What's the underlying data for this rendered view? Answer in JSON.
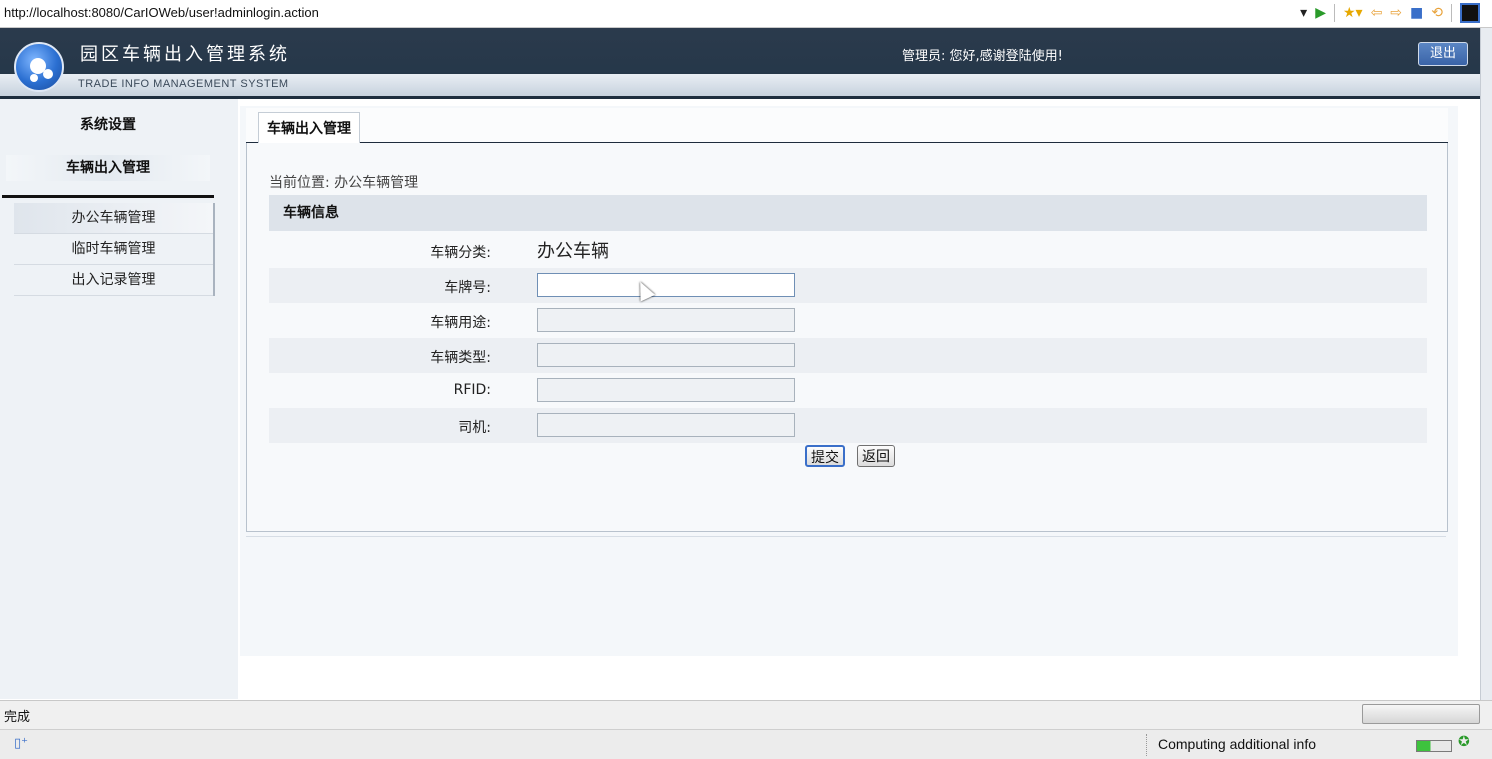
{
  "browser": {
    "url": "http://localhost:8080/CarIOWeb/user!adminlogin.action",
    "toolbar_icons": [
      "dropdown-icon",
      "play-icon",
      "star-icon",
      "back-icon",
      "forward-icon",
      "stop-icon",
      "refresh-icon",
      "window-icon"
    ]
  },
  "header": {
    "title": "园区车辆出入管理系统",
    "subtitle": "TRADE INFO MANAGEMENT SYSTEM",
    "greeting": "管理员:  您好,感谢登陆使用!",
    "logout_label": "退出"
  },
  "sidebar": {
    "system_settings": "系统设置",
    "section": "车辆出入管理",
    "items": [
      {
        "label": "办公车辆管理"
      },
      {
        "label": "临时车辆管理"
      },
      {
        "label": "出入记录管理"
      }
    ]
  },
  "main": {
    "tab_label": "车辆出入管理",
    "breadcrumb": "当前位置:  办公车辆管理",
    "section_title": "车辆信息",
    "form": {
      "category_label": "车辆分类:",
      "category_value": "办公车辆",
      "plate_label": "车牌号:",
      "plate_value": "",
      "usage_label": "车辆用途:",
      "usage_value": "",
      "type_label": "车辆类型:",
      "type_value": "",
      "rfid_label": "RFID:",
      "rfid_value": "",
      "driver_label": "司机:",
      "driver_value": ""
    },
    "submit_label": "提交",
    "back_label": "返回"
  },
  "status": {
    "done_text": "完成",
    "info_text": "Computing additional info"
  },
  "colors": {
    "header_bg": "#26384a",
    "accent": "#3a6fc9",
    "panel_bg": "#f4f7fa"
  }
}
